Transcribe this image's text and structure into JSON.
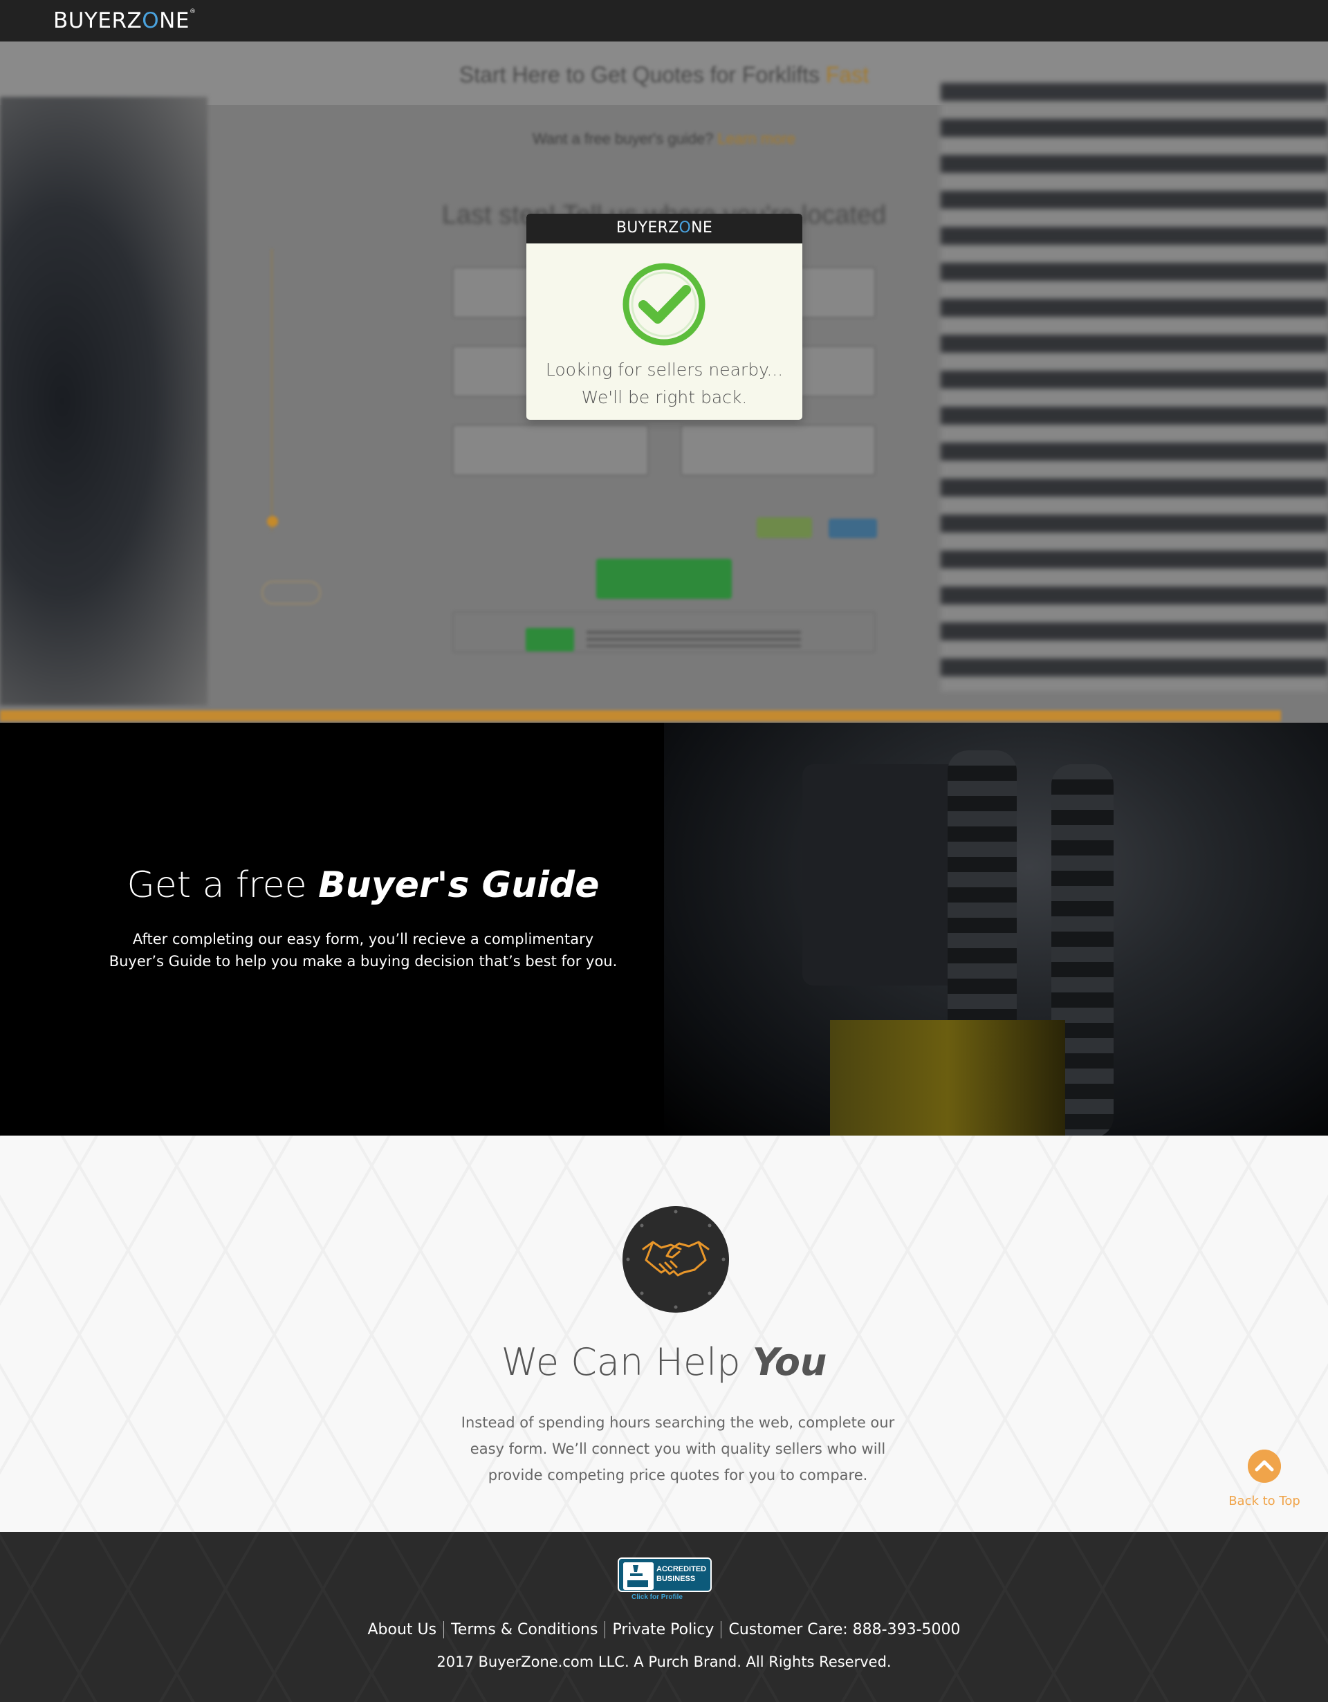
{
  "header": {
    "logo_text_a": "BUYERZ",
    "logo_text_o": "O",
    "logo_text_b": "NE",
    "logo_mark": "®"
  },
  "hero": {
    "headline": "Start Here to Get Quotes for Forklifts",
    "headline_accent": "Fast",
    "subline": "Want a free buyer's guide?",
    "subline_accent": "Learn more",
    "step_title": "Last step! Tell us where you're located"
  },
  "modal": {
    "logo_text_a": "BUYERZ",
    "logo_text_o": "O",
    "logo_text_b": "NE",
    "line1": "Looking for sellers nearby...",
    "line2": "We'll be right back.",
    "check_icon": "checkmark-circle-icon",
    "check_color": "#5cbd3b"
  },
  "guide": {
    "title_plain": "Get a free ",
    "title_bold": "Buyer's Guide",
    "line1": "After completing our easy form, you’ll recieve a complimentary",
    "line2": "Buyer’s Guide to help you make a buying decision that’s best for you."
  },
  "help": {
    "icon": "handshake-icon",
    "title_plain": "We Can Help ",
    "title_bold": "You",
    "line1": "Instead of spending hours searching the web, complete our",
    "line2": "easy form. We’ll connect you with quality sellers who will",
    "line3": "provide competing price quotes for you to compare."
  },
  "back_to_top": {
    "label": "Back to Top",
    "color": "#f0a44a"
  },
  "footer": {
    "bbb_line1": "ACCREDITED",
    "bbb_line2": "BUSINESS",
    "bbb_sub": "Click for Profile",
    "links": [
      "About Us",
      "Terms & Conditions",
      "Private Policy",
      "Customer Care: 888-393-5000"
    ],
    "copyright": "2017 BuyerZone.com LLC. A Purch Brand. All Rights Reserved."
  },
  "colors": {
    "accent": "#c48a30",
    "dark": "#222222",
    "bbb_blue": "#0d5a7a"
  }
}
